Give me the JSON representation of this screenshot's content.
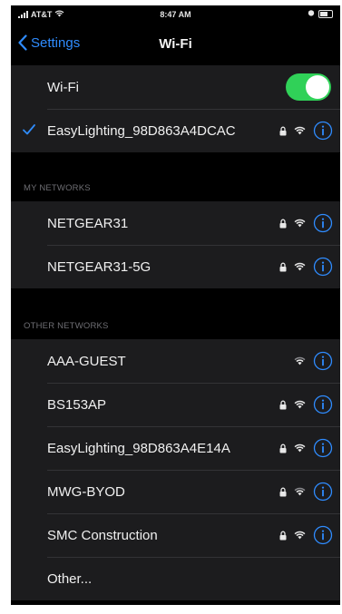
{
  "status_bar": {
    "carrier": "AT&T",
    "time": "8:47 AM"
  },
  "nav": {
    "back_label": "Settings",
    "title": "Wi-Fi"
  },
  "wifi_toggle": {
    "label": "Wi-Fi",
    "on": true
  },
  "connected_network": {
    "name": "EasyLighting_98D863A4DCAC",
    "secured": true
  },
  "my_networks": {
    "header": "MY NETWORKS",
    "items": [
      {
        "name": "NETGEAR31",
        "secured": true
      },
      {
        "name": "NETGEAR31-5G",
        "secured": true
      }
    ]
  },
  "other_networks": {
    "header": "OTHER NETWORKS",
    "items": [
      {
        "name": "AAA-GUEST",
        "secured": false
      },
      {
        "name": "BS153AP",
        "secured": true
      },
      {
        "name": "EasyLighting_98D863A4E14A",
        "secured": true
      },
      {
        "name": "MWG-BYOD",
        "secured": true
      },
      {
        "name": "SMC Construction",
        "secured": true
      }
    ],
    "other_label": "Other..."
  },
  "colors": {
    "accent": "#2f8cff",
    "toggle_on": "#30d158",
    "cell_bg": "#1c1c1e",
    "background": "#000000"
  }
}
